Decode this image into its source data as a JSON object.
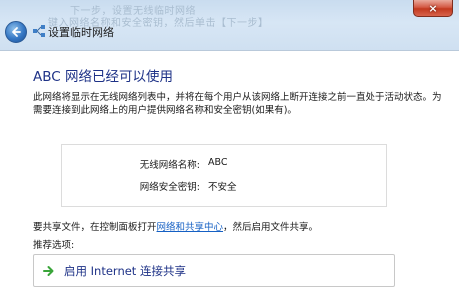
{
  "window": {
    "ghost_line_1": "下一步，设置无线临时网络",
    "ghost_line_2": "键入网络名称和安全密钥，然后单击【下一步】",
    "close_label": "×",
    "title": "设置临时网络"
  },
  "main": {
    "headline": "ABC 网络已经可以使用",
    "description": "此网络将显示在无线网络列表中，并将在每个用户从该网络上断开连接之前一直处于活动状态。为需要连接到此网络上的用户提供网络名称和安全密钥(如果有)。",
    "info": {
      "name_label": "无线网络名称:",
      "name_value": "ABC",
      "key_label": "网络安全密钥:",
      "key_value": "不安全"
    },
    "share_prefix": "要共享文件，在控制面板打开",
    "share_link": "网络和共享中心",
    "share_suffix": "，然后启用文件共享。",
    "recommend_label": "推荐选项:",
    "command_link": "启用 Internet 连接共享"
  },
  "colors": {
    "accent_link": "#1560c4",
    "headline": "#1e3287",
    "arrow_green": "#3aa53a"
  },
  "icons": {
    "back": "back-arrow-icon",
    "title": "network-icon",
    "command": "green-arrow-icon"
  }
}
